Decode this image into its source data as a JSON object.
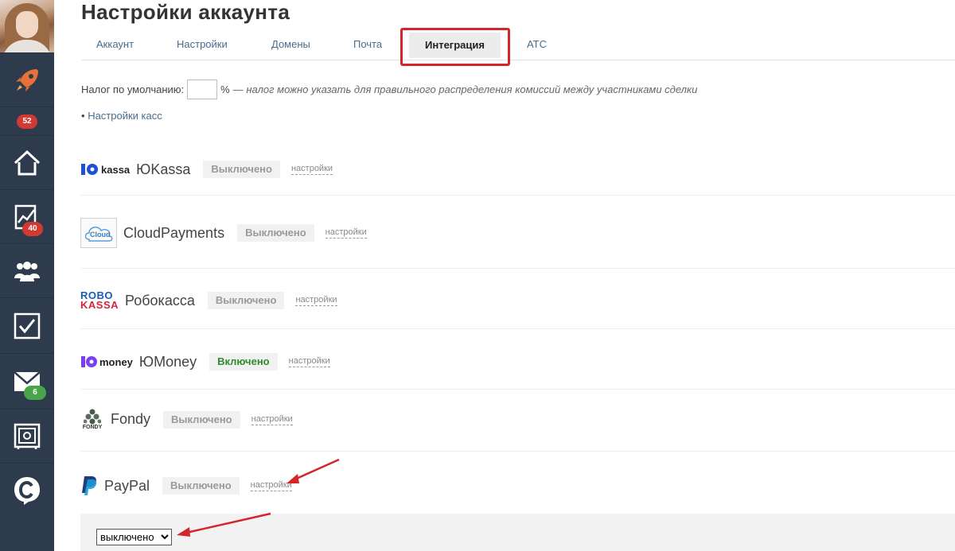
{
  "sidebar": {
    "avatar": "avatar",
    "items": [
      {
        "icon": "rocket-icon",
        "badge": ""
      },
      {
        "icon": "notifications-badge",
        "badge": "52"
      },
      {
        "icon": "home-icon",
        "badge": ""
      },
      {
        "icon": "analytics-chart-icon",
        "badge": "40"
      },
      {
        "icon": "users-group-icon",
        "badge": ""
      },
      {
        "icon": "task-check-icon",
        "badge": ""
      },
      {
        "icon": "mail-icon",
        "badge": "6"
      },
      {
        "icon": "safe-box-icon",
        "badge": ""
      },
      {
        "icon": "logo-c-icon",
        "badge": ""
      }
    ],
    "colors": {
      "bg": "#2e3b4c",
      "rocket": "#e8713a",
      "badge_red": "#d03a32",
      "badge_green": "#4aa54a"
    }
  },
  "header": {
    "title": "Настройки аккаунта"
  },
  "tabs": [
    {
      "label": "Аккаунт"
    },
    {
      "label": "Настройки"
    },
    {
      "label": "Домены"
    },
    {
      "label": "Почта"
    },
    {
      "label": "Интеграция",
      "active": true
    },
    {
      "label": "АТС"
    }
  ],
  "tax": {
    "label": "Налог по умолчанию:",
    "value": "",
    "unit": "%",
    "hint": "— налог можно указать для правильного распределения комиссий между участниками сделки"
  },
  "kassa_link": {
    "bullet": "•",
    "label": "Настройки касс"
  },
  "providers": [
    {
      "logo_text": "kassa",
      "name": "ЮKassa",
      "status": "Выключено",
      "settings": "настройки"
    },
    {
      "logo_text": "Cloud",
      "name": "CloudPayments",
      "status": "Выключено",
      "settings": "настройки"
    },
    {
      "logo_text_top": "ROBO",
      "logo_text_bottom": "KASSA",
      "name": "Робокасса",
      "status": "Выключено",
      "settings": "настройки"
    },
    {
      "logo_text": "money",
      "name": "ЮMoney",
      "status": "Включено",
      "settings": "настройки"
    },
    {
      "logo_text": "FONDY",
      "name": "Fondy",
      "status": "Выключено",
      "settings": "настройки"
    },
    {
      "name": "PayPal",
      "status": "Выключено",
      "settings": "настройки"
    }
  ],
  "paypal_panel": {
    "select_value": "выключено"
  },
  "colors": {
    "link": "#4a6c8c",
    "status_on": "#2d8a2d",
    "status_off": "#9a9a9a",
    "highlight": "#d2262b",
    "yookassa_blue": "#1d4fd8",
    "robo_blue": "#1a5bb8",
    "robo_red": "#d4243b",
    "yoomoney_purple": "#7b3ff2",
    "paypal_dark": "#253b80",
    "paypal_light": "#179bd7"
  }
}
